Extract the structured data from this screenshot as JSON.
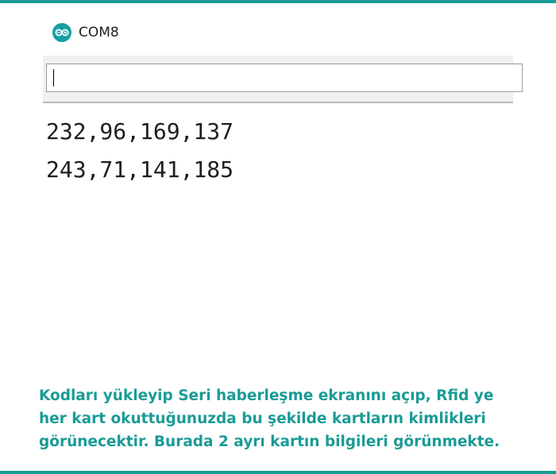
{
  "colors": {
    "frame_accent": "#1a9b96",
    "caption_text": "#1a9b96",
    "app_icon_bg": "#15a0a4"
  },
  "window": {
    "icon": "arduino-infinity-icon",
    "title": "COM8"
  },
  "serial_input": {
    "value": ""
  },
  "serial_output": {
    "lines": [
      "232,96,169,137",
      "243,71,141,185"
    ]
  },
  "caption": {
    "lines": [
      "Kodları yükleyip Seri haberleşme ekranını açıp, Rfid ye",
      "her kart okuttuğunuzda bu şekilde kartların kimlikleri",
      "görünecektir. Burada 2 ayrı kartın bilgileri görünmekte."
    ]
  }
}
